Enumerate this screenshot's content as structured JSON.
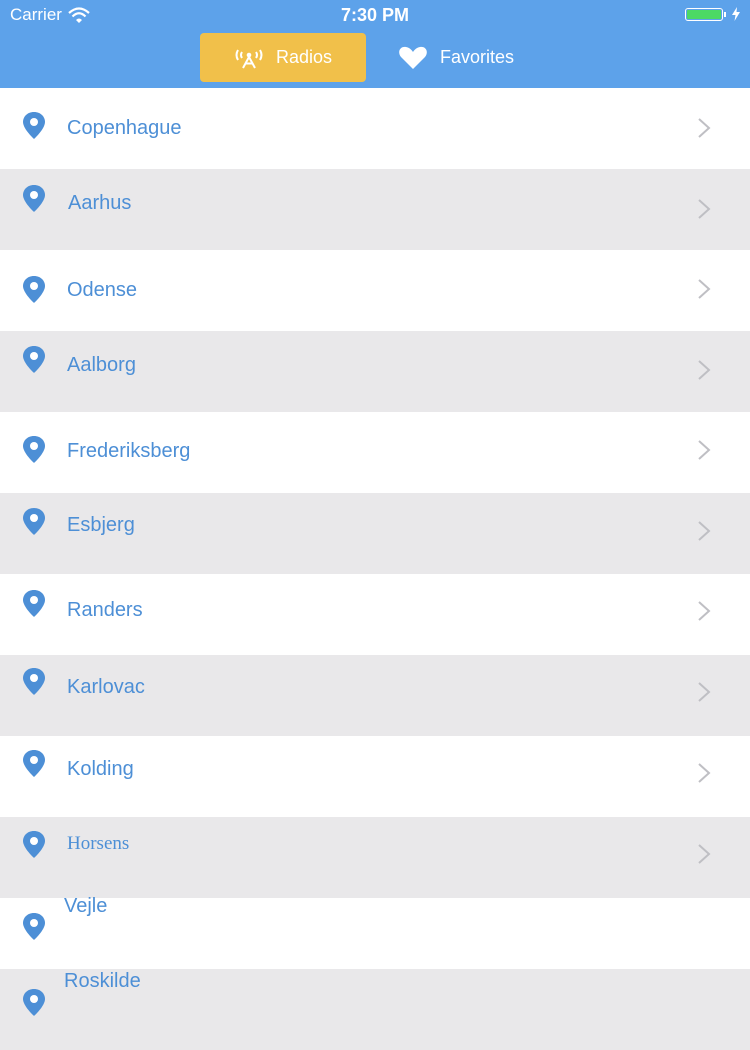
{
  "status_bar": {
    "carrier": "Carrier",
    "time": "7:30 PM",
    "battery_level": 1.0,
    "battery_color": "#4cd964"
  },
  "tabs": [
    {
      "label": "Radios",
      "icon": "radio-tower-icon",
      "selected": true
    },
    {
      "label": "Favorites",
      "icon": "heart-icon",
      "selected": false
    }
  ],
  "colors": {
    "header": "#5da2ea",
    "selected_tab": "#f1c04a",
    "city_text": "#4d8fd6",
    "row_alt": "#e9e8ea"
  },
  "cities": [
    "Copenhague",
    "Aarhus",
    "Odense",
    "Aalborg",
    "Frederiksberg",
    "Esbjerg",
    "Randers",
    "Karlovac",
    "Kolding",
    "Horsens",
    "Vejle",
    "Roskilde"
  ]
}
